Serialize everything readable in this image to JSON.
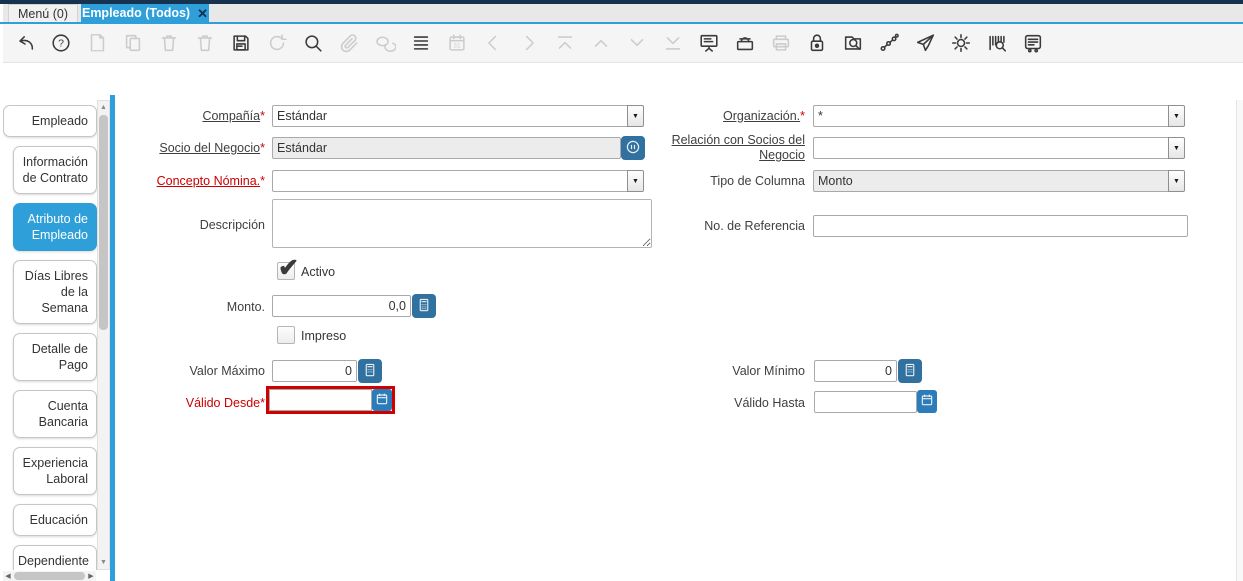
{
  "colors": {
    "accent_blue": "#2e9fd9",
    "navy": "#16324f",
    "button_blue": "#31719f",
    "calendar_button_blue": "#2d7cba",
    "error_red": "#d10000",
    "toolbar_bg": "#f5f5f5"
  },
  "window_tabs": [
    {
      "label": "Menú (0)",
      "active": false
    },
    {
      "label": "Empleado (Todos)",
      "active": true,
      "close_icon": "✕"
    }
  ],
  "toolbar": {
    "buttons": [
      {
        "icon": "undo",
        "enabled": true
      },
      {
        "icon": "help",
        "enabled": true
      },
      {
        "icon": "new-record",
        "enabled": false
      },
      {
        "icon": "copy-record",
        "enabled": false
      },
      {
        "icon": "delete-record",
        "enabled": false
      },
      {
        "icon": "delete-selection",
        "enabled": false
      },
      {
        "icon": "save",
        "enabled": true
      },
      {
        "icon": "refresh",
        "enabled": false
      },
      {
        "icon": "find",
        "enabled": true
      },
      {
        "icon": "attachment",
        "enabled": false
      },
      {
        "icon": "chat",
        "enabled": false
      },
      {
        "icon": "grid-toggle",
        "enabled": true
      },
      {
        "icon": "calendar",
        "enabled": false
      },
      {
        "icon": "previous-record",
        "enabled": false
      },
      {
        "icon": "next-record",
        "enabled": false
      },
      {
        "icon": "first-record",
        "enabled": false
      },
      {
        "icon": "parent-record",
        "enabled": false
      },
      {
        "icon": "detail-record",
        "enabled": false
      },
      {
        "icon": "last-record",
        "enabled": false
      },
      {
        "icon": "report",
        "enabled": true
      },
      {
        "icon": "archive",
        "enabled": true
      },
      {
        "icon": "print",
        "enabled": false
      },
      {
        "icon": "lock",
        "enabled": true
      },
      {
        "icon": "zoom-across",
        "enabled": true
      },
      {
        "icon": "workflow",
        "enabled": true
      },
      {
        "icon": "send-mail",
        "enabled": true
      },
      {
        "icon": "preferences",
        "enabled": true
      },
      {
        "icon": "product-info",
        "enabled": true
      },
      {
        "icon": "log",
        "enabled": true
      }
    ]
  },
  "sidebar": {
    "tabs": [
      {
        "label": "Empleado",
        "active": false
      },
      {
        "label": "Información de Contrato",
        "active": false
      },
      {
        "label": "Atributo de Empleado",
        "active": true
      },
      {
        "label": "Días Libres de la Semana",
        "active": false
      },
      {
        "label": "Detalle de Pago",
        "active": false
      },
      {
        "label": "Cuenta Bancaria",
        "active": false
      },
      {
        "label": "Experiencia Laboral",
        "active": false
      },
      {
        "label": "Educación",
        "active": false
      },
      {
        "label": "Dependiente",
        "active": false
      }
    ]
  },
  "form": {
    "required_mark": "*",
    "compania": {
      "label": "Compañía",
      "value": "Estándar"
    },
    "organizacion": {
      "label": "Organización.",
      "value": "*"
    },
    "socio": {
      "label": "Socio del Negocio",
      "value": "Estándar"
    },
    "relacion": {
      "label": "Relación con Socios del Negocio",
      "value": ""
    },
    "concepto": {
      "label": "Concepto Nómina.",
      "value": ""
    },
    "tipo_columna": {
      "label": "Tipo de Columna",
      "value": "Monto"
    },
    "descripcion": {
      "label": "Descripción",
      "value": ""
    },
    "no_referencia": {
      "label": "No. de Referencia",
      "value": ""
    },
    "activo": {
      "label": "Activo",
      "checked": true
    },
    "monto": {
      "label": "Monto.",
      "value": "0,0"
    },
    "impreso": {
      "label": "Impreso",
      "checked": false
    },
    "valor_maximo": {
      "label": "Valor Máximo",
      "value": "0"
    },
    "valor_minimo": {
      "label": "Valor Mínimo",
      "value": "0"
    },
    "valido_desde": {
      "label": "Válido Desde",
      "value": ""
    },
    "valido_hasta": {
      "label": "Válido Hasta",
      "value": ""
    }
  }
}
